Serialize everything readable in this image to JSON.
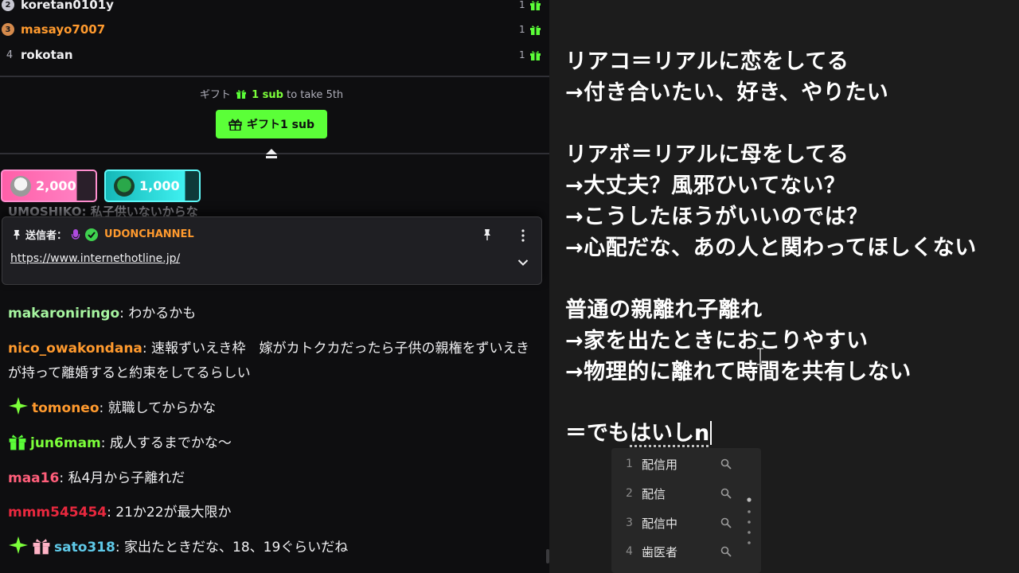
{
  "leaderboard": [
    {
      "rank": "2",
      "name": "koretan0101y",
      "count": "1",
      "color": "#efeff1",
      "medal": "silver"
    },
    {
      "rank": "3",
      "name": "masayo7007",
      "count": "1",
      "color": "#ff9a2e",
      "medal": "bronze"
    },
    {
      "rank": "4",
      "name": "rokotan",
      "count": "1",
      "color": "#efeff1",
      "medal": "none"
    }
  ],
  "gift": {
    "caption_pre": "ギフト",
    "caption_hl": "1 sub",
    "caption_post": "to take 5th",
    "button_label": "ギフト1 sub"
  },
  "pills": [
    {
      "amount": "2,000"
    },
    {
      "amount": "1,000"
    }
  ],
  "ghost_line": "UMOSHIKO: 私子供いないからな",
  "pinned": {
    "label": "送信者：",
    "sender": "UDONCHANNEL",
    "link": "https://www.internethotline.jp/"
  },
  "messages": [
    {
      "user": "makaroniringo",
      "color": "#a6f5a0",
      "text": "わかるかも"
    },
    {
      "user": "nico_owakondana",
      "color": "#ff9a2e",
      "text": "速報ずいえき枠　嫁がカトクカだったら子供の親権をずいえきが持って離婚すると約束をしてるらしい"
    },
    {
      "user": "tomoneo",
      "color": "#ff9a2e",
      "text": "就職してからかな"
    },
    {
      "user": "jun6mam",
      "color": "#7cff3a",
      "text": "成人するまでかな〜"
    },
    {
      "user": "maa16",
      "color": "#ff5e7a",
      "text": "私4月から子離れだ"
    },
    {
      "user": "mmm545454",
      "color": "#e8283e",
      "text": "21か22が最大限か"
    },
    {
      "user": "sato318",
      "color": "#5fc9e8",
      "text": "家出たときだな、18、19ぐらいだね"
    }
  ],
  "notes": [
    "リアコ＝リアルに恋をしてる",
    "→付き合いたい、好き、やりたい",
    "リアボ＝リアルに母をしてる",
    "→大丈夫？風邪ひいてない？",
    "→こうしたほうがいいのでは？",
    "→心配だな、あの人と関わってほしくない",
    "普通の親離れ子離れ",
    "→家を出たときにおこりやすい",
    "→物理的に離れて時間を共有しない"
  ],
  "ime": {
    "committed": "＝でも",
    "composing": "はいしn",
    "candidates": [
      {
        "num": "1",
        "text": "配信用"
      },
      {
        "num": "2",
        "text": "配信"
      },
      {
        "num": "3",
        "text": "配信中"
      },
      {
        "num": "4",
        "text": "歯医者"
      }
    ]
  }
}
